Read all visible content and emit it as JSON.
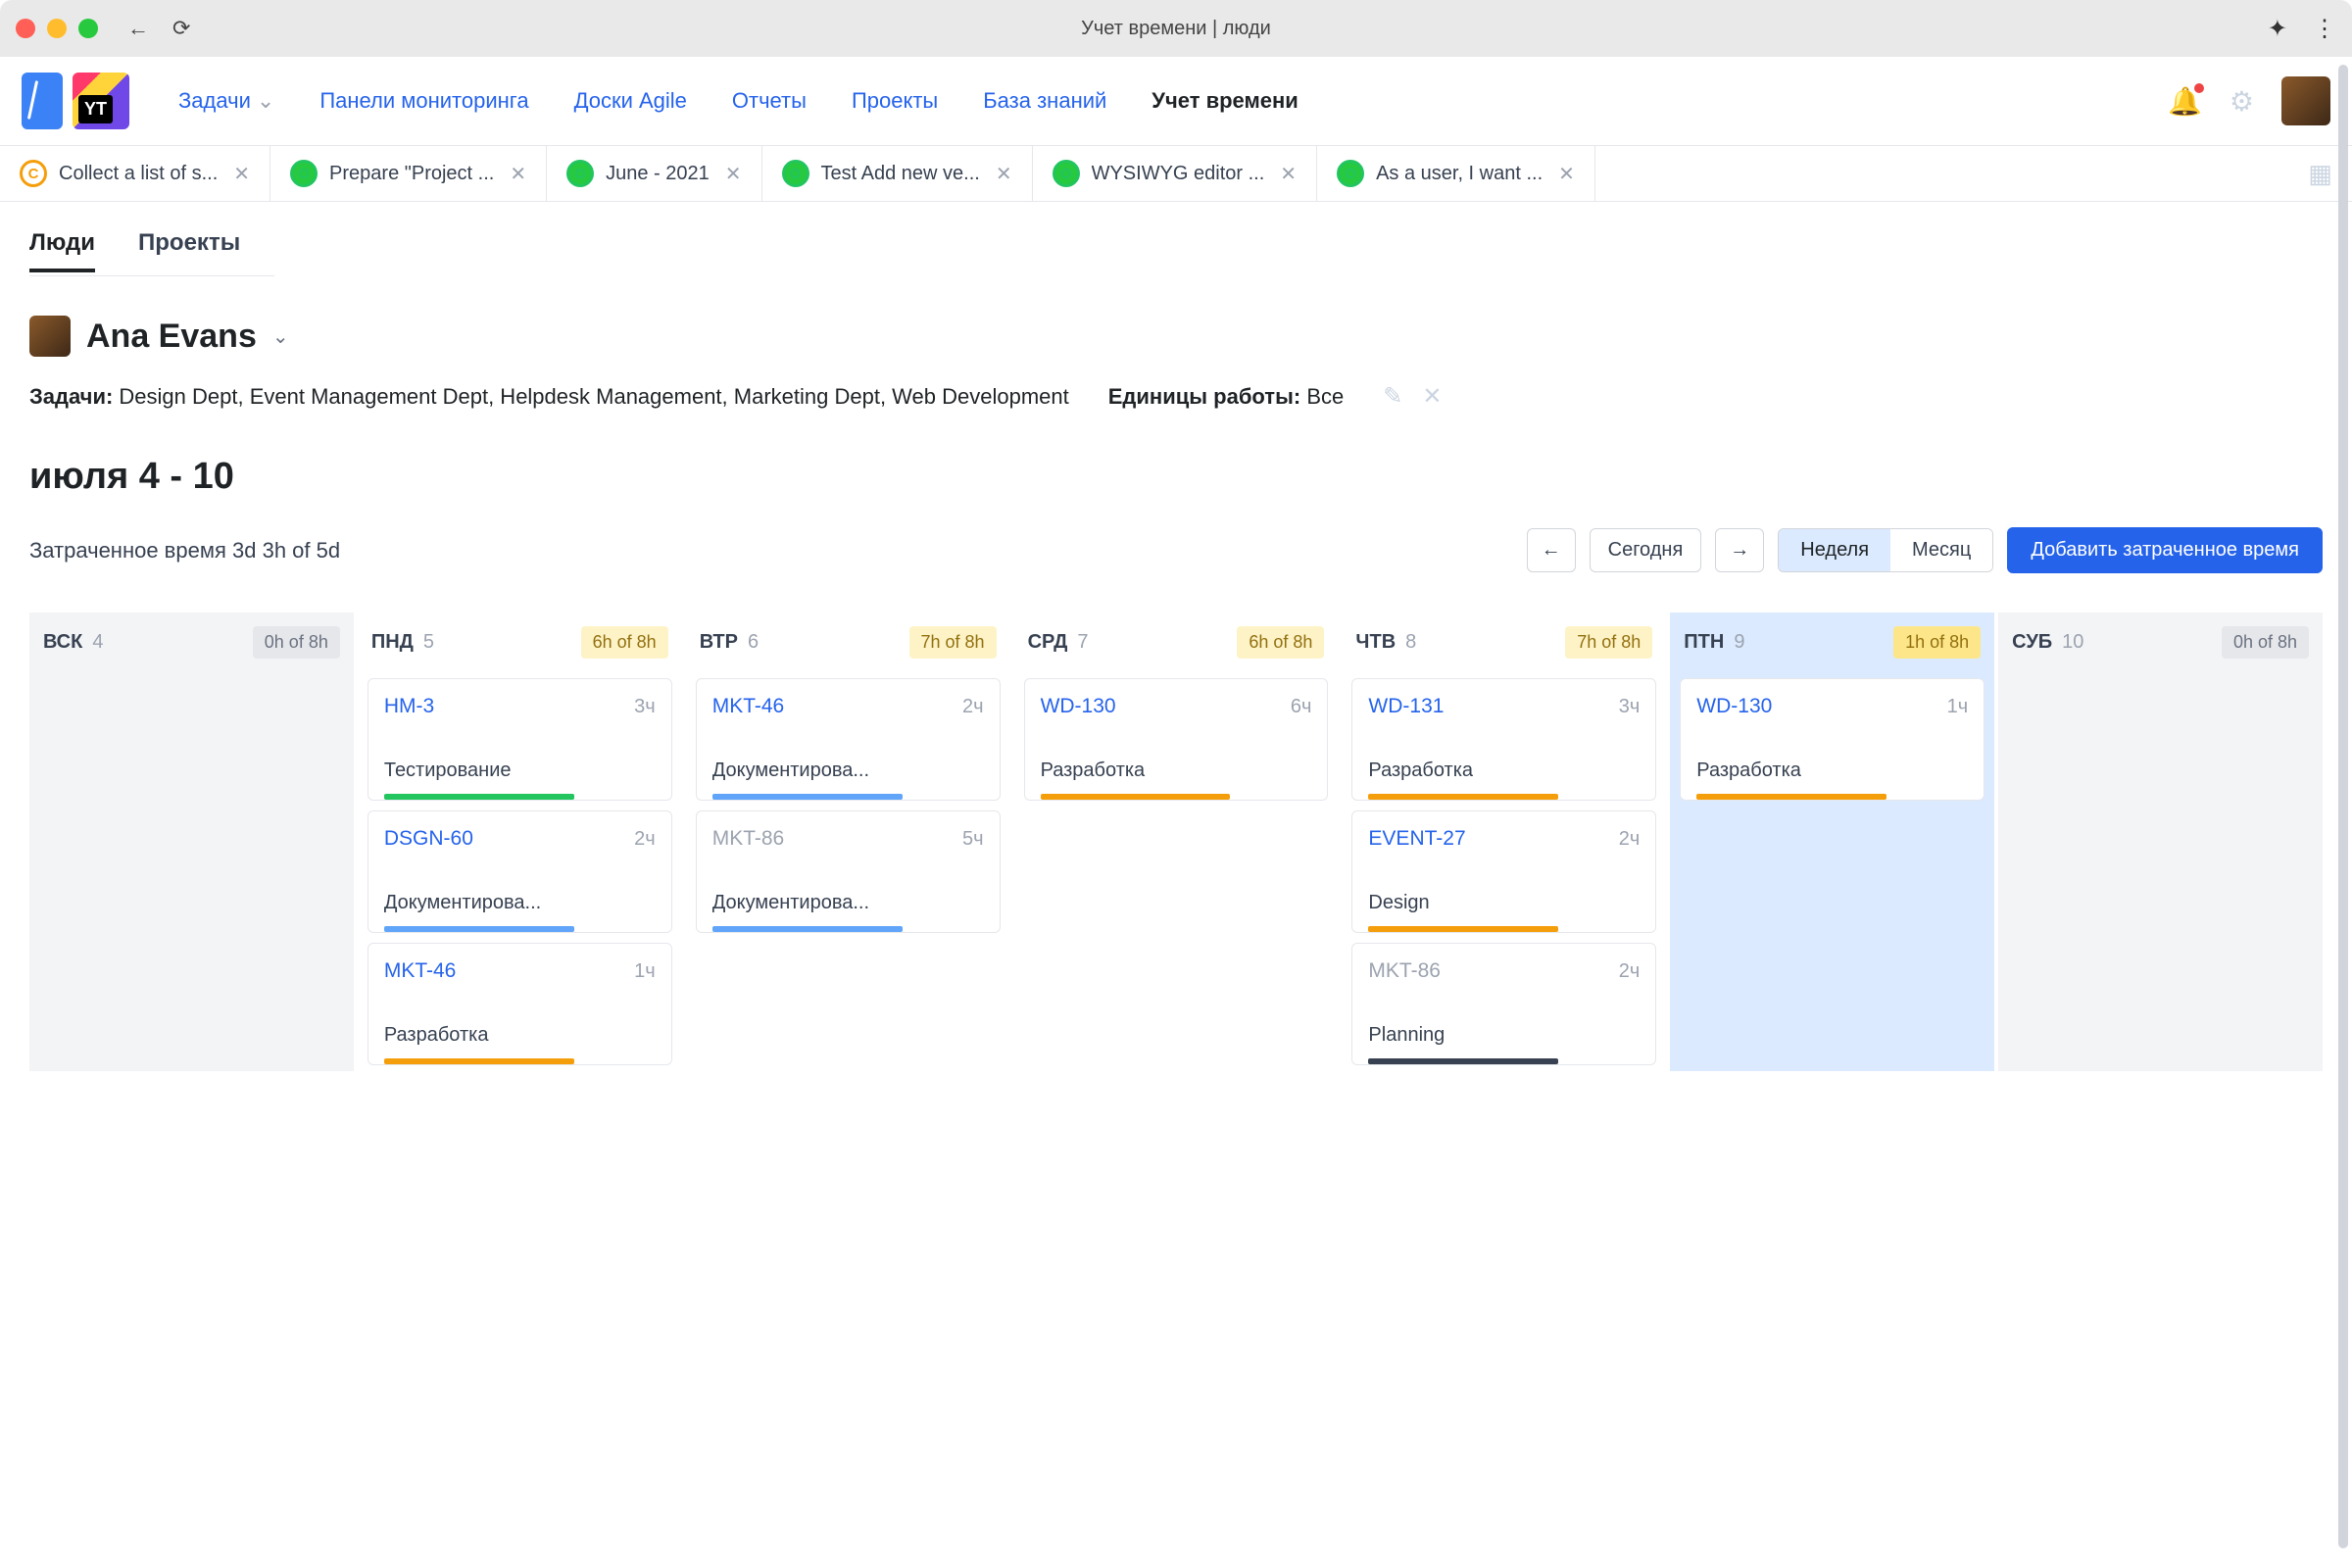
{
  "titlebar": {
    "title": "Учет времени | люди"
  },
  "nav": {
    "items": [
      "Задачи",
      "Панели мониторинга",
      "Доски Agile",
      "Отчеты",
      "Проекты",
      "База знаний",
      "Учет времени"
    ],
    "active_index": 6
  },
  "tabs": [
    {
      "icon": "C",
      "color": "orange",
      "label": "Collect a list of s..."
    },
    {
      "icon": "O",
      "color": "green",
      "label": "Prepare \"Project ..."
    },
    {
      "icon": "O",
      "color": "green",
      "label": "June - 2021"
    },
    {
      "icon": "O",
      "color": "green",
      "label": "Test Add new ve..."
    },
    {
      "icon": "O",
      "color": "green",
      "label": "WYSIWYG editor ..."
    },
    {
      "icon": "O",
      "color": "green",
      "label": "As a user, I want ..."
    }
  ],
  "view_tabs": {
    "items": [
      "Люди",
      "Проекты"
    ],
    "active_index": 0
  },
  "user": {
    "name": "Ana Evans"
  },
  "meta": {
    "tasks_label": "Задачи:",
    "tasks_value": "Design Dept, Event Management Dept, Helpdesk Management, Marketing Dept, Web Development",
    "units_label": "Единицы работы:",
    "units_value": "Все"
  },
  "date_range": "июля 4 - 10",
  "spent": {
    "label": "Затраченное время",
    "value": "3d 3h of 5d"
  },
  "controls": {
    "today": "Сегодня",
    "week": "Неделя",
    "month": "Месяц",
    "add": "Добавить затраченное время"
  },
  "days": [
    {
      "name": "ВСК",
      "num": "4",
      "badge": "0h of 8h",
      "kind": "dim",
      "cards": []
    },
    {
      "name": "ПНД",
      "num": "5",
      "badge": "6h of 8h",
      "kind": "",
      "cards": [
        {
          "id": "HM-3",
          "hours": "3ч",
          "title": "Тестирование",
          "bar": "green",
          "muted": false
        },
        {
          "id": "DSGN-60",
          "hours": "2ч",
          "title": "Документирова...",
          "bar": "blue",
          "muted": false
        },
        {
          "id": "MKT-46",
          "hours": "1ч",
          "title": "Разработка",
          "bar": "amber",
          "muted": false
        }
      ]
    },
    {
      "name": "ВТР",
      "num": "6",
      "badge": "7h of 8h",
      "kind": "",
      "cards": [
        {
          "id": "MKT-46",
          "hours": "2ч",
          "title": "Документирова...",
          "bar": "blue",
          "muted": false
        },
        {
          "id": "MKT-86",
          "hours": "5ч",
          "title": "Документирова...",
          "bar": "blue",
          "muted": true
        }
      ]
    },
    {
      "name": "СРД",
      "num": "7",
      "badge": "6h of 8h",
      "kind": "",
      "cards": [
        {
          "id": "WD-130",
          "hours": "6ч",
          "title": "Разработка",
          "bar": "amber",
          "muted": false
        }
      ]
    },
    {
      "name": "ЧТВ",
      "num": "8",
      "badge": "7h of 8h",
      "kind": "",
      "cards": [
        {
          "id": "WD-131",
          "hours": "3ч",
          "title": "Разработка",
          "bar": "amber",
          "muted": false
        },
        {
          "id": "EVENT-27",
          "hours": "2ч",
          "title": "Design",
          "bar": "amber",
          "muted": false
        },
        {
          "id": "MKT-86",
          "hours": "2ч",
          "title": "Planning",
          "bar": "dark",
          "muted": true
        }
      ]
    },
    {
      "name": "ПТН",
      "num": "9",
      "badge": "1h of 8h",
      "kind": "today",
      "cards": [
        {
          "id": "WD-130",
          "hours": "1ч",
          "title": "Разработка",
          "bar": "amber",
          "muted": false
        }
      ]
    },
    {
      "name": "СУБ",
      "num": "10",
      "badge": "0h of 8h",
      "kind": "dim",
      "cards": []
    }
  ]
}
